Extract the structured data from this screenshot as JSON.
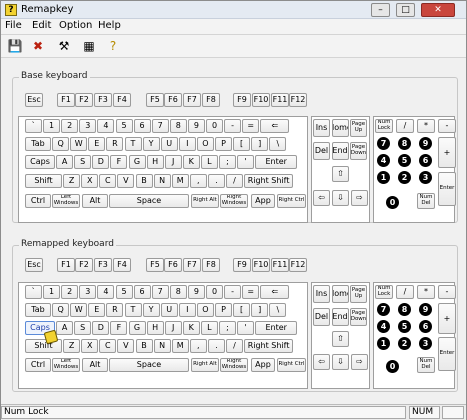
{
  "app": {
    "title": "Remapkey",
    "icon": "keyboard-yellow-icon"
  },
  "window_buttons": [
    "minimize",
    "maximize",
    "close"
  ],
  "menus": [
    "File",
    "Edit",
    "Option",
    "Help"
  ],
  "toolbar": [
    "save-icon",
    "reset-icon",
    "tools-icon",
    "view-icon",
    "help-icon"
  ],
  "groups": {
    "base": "Base keyboard",
    "remapped": "Remapped keyboard"
  },
  "keyboard": {
    "fn_row": [
      "Esc",
      "F1",
      "F2",
      "F3",
      "F4",
      "F5",
      "F6",
      "F7",
      "F8",
      "F9",
      "F10",
      "F11",
      "F12"
    ],
    "row1": [
      "`",
      "1",
      "2",
      "3",
      "4",
      "5",
      "6",
      "7",
      "8",
      "9",
      "0",
      "-",
      "=",
      "⇐"
    ],
    "row2": [
      "Tab",
      "Q",
      "W",
      "E",
      "R",
      "T",
      "Y",
      "U",
      "I",
      "O",
      "P",
      "[",
      "]",
      "\\"
    ],
    "row3": [
      "Caps",
      "A",
      "S",
      "D",
      "F",
      "G",
      "H",
      "J",
      "K",
      "L",
      ";",
      "'",
      "Enter"
    ],
    "row4": [
      "Shift",
      "Z",
      "X",
      "C",
      "V",
      "B",
      "N",
      "M",
      ",",
      ".",
      "/",
      "Right Shift"
    ],
    "row5": [
      "Ctrl",
      "Left\nWindows",
      "Alt",
      "Space",
      "Right Alt",
      "Right\nWindows",
      "App",
      "Right Ctrl"
    ],
    "nav_top": [
      "Ins",
      "Home",
      "Page\nUp"
    ],
    "nav_bottom": [
      "Del",
      "End",
      "Page\nDown"
    ],
    "arrows": [
      "⇧",
      "⇦",
      "⇩",
      "⇨"
    ],
    "numpad": {
      "top": [
        "Num\nLock",
        "/",
        "*",
        "-"
      ],
      "digits": [
        "7",
        "8",
        "9",
        "4",
        "5",
        "6",
        "1",
        "2",
        "3"
      ],
      "plus": "+",
      "enter": "Enter",
      "zero": "0",
      "del": "Num\nDel"
    }
  },
  "status": {
    "left": "Num Lock",
    "num": "NUM"
  }
}
